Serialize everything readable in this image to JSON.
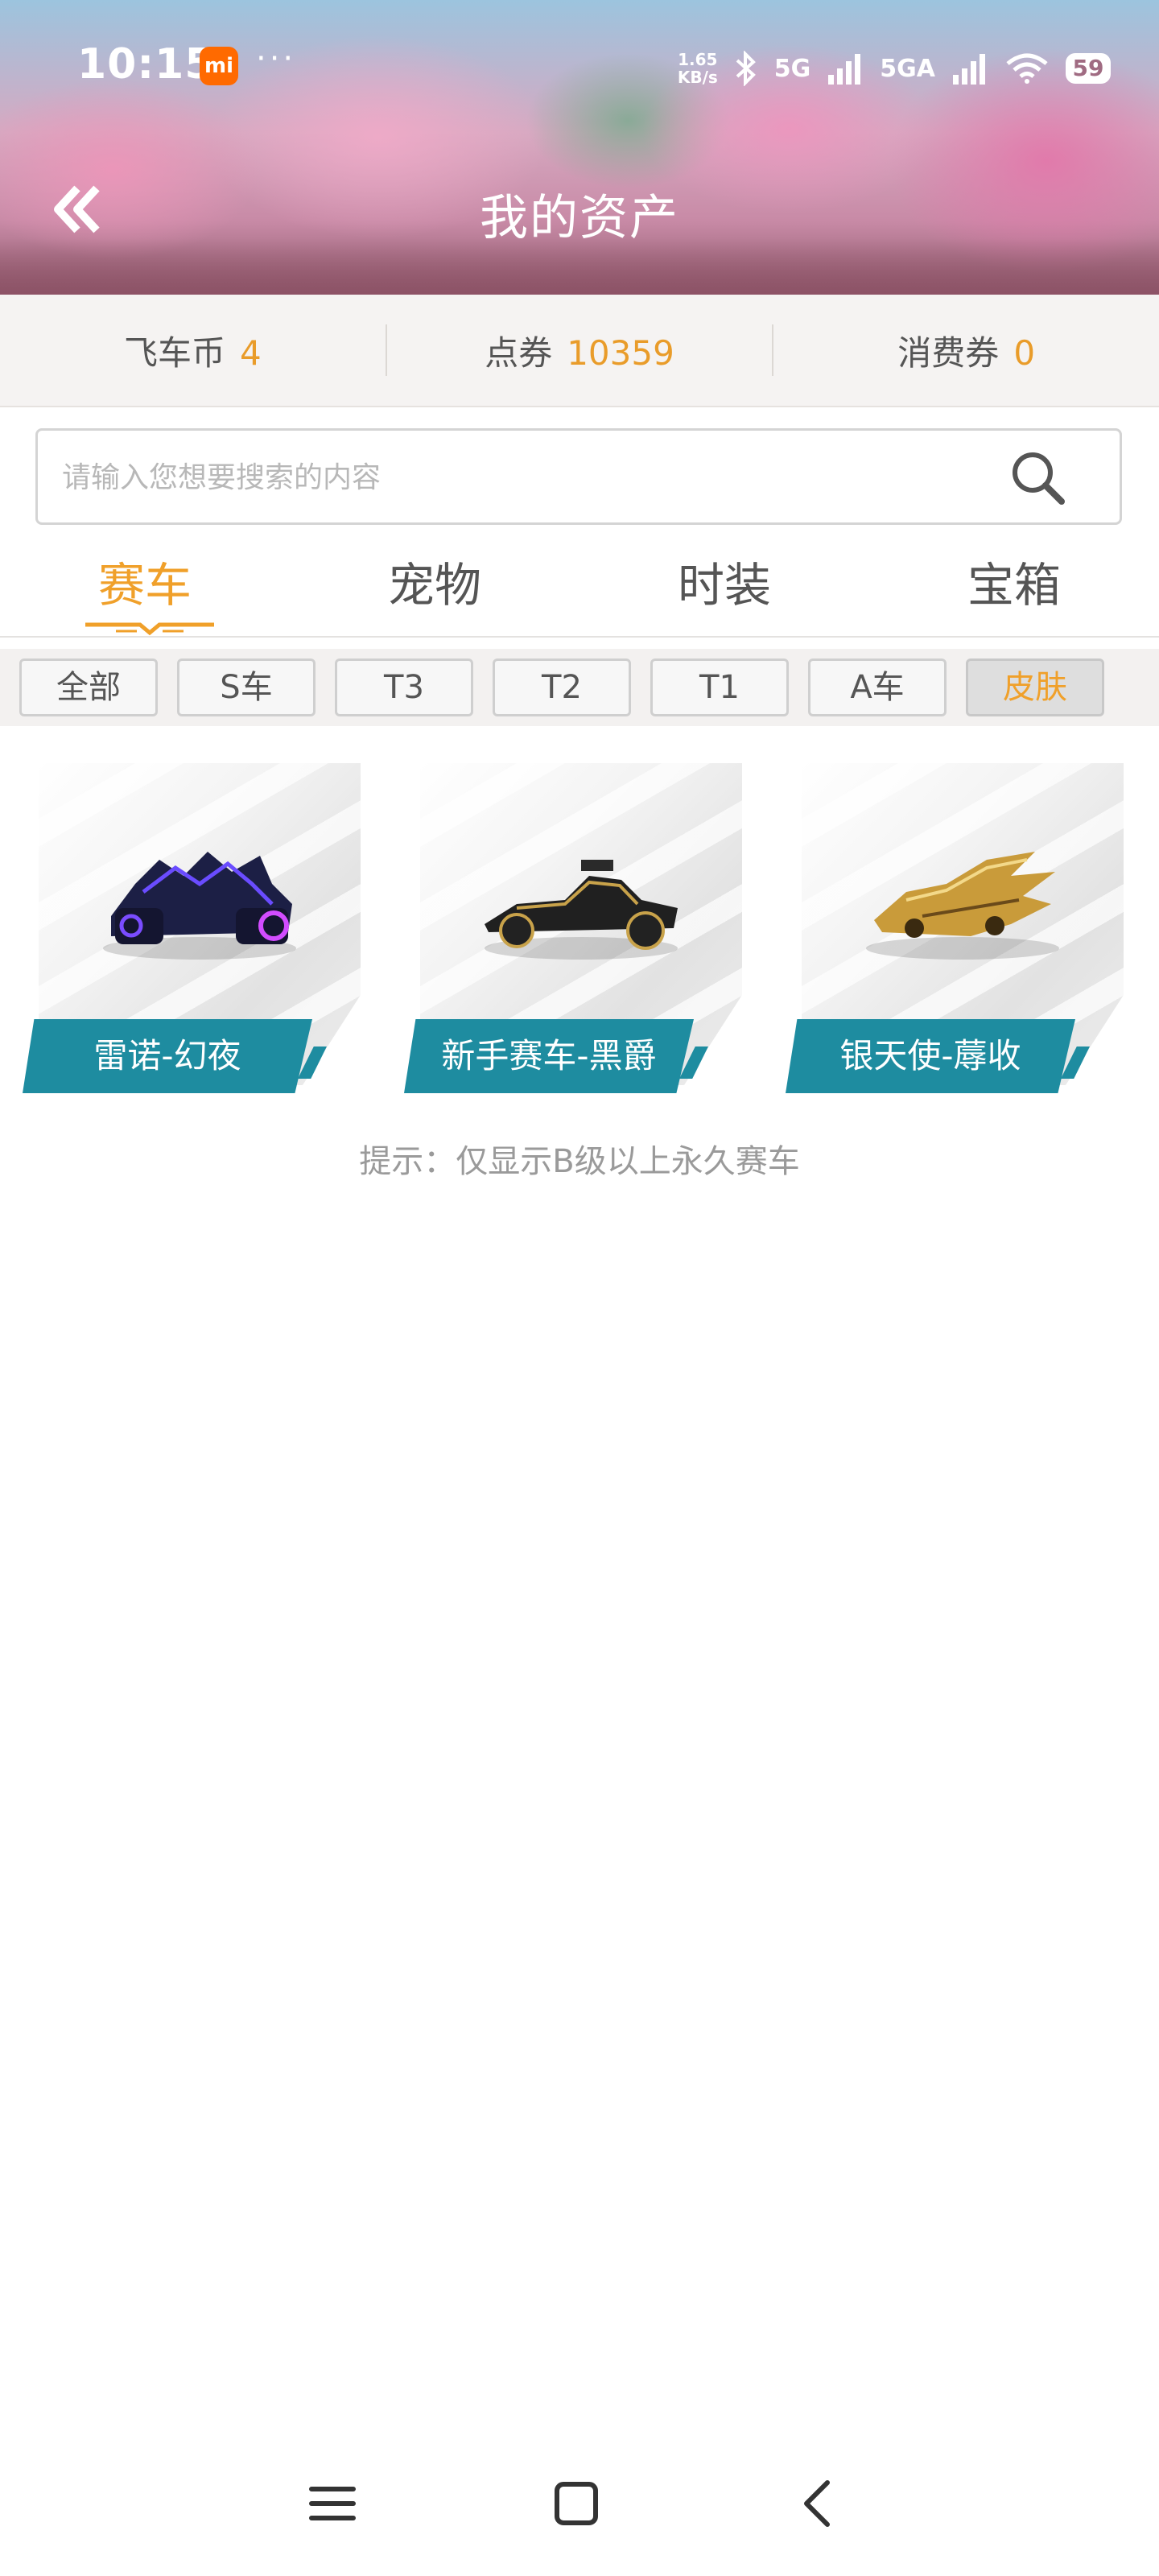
{
  "status_bar": {
    "time": "10:15",
    "app_badge": "mi",
    "dots": "···",
    "net_speed_value": "1.65",
    "net_speed_unit": "KB/s",
    "signal1": "5G",
    "signal2": "5GA",
    "battery": "59"
  },
  "header": {
    "title": "我的资产",
    "back_icon": "double-chevron-left-icon"
  },
  "currencies": [
    {
      "label": "飞车币",
      "value": "4"
    },
    {
      "label": "点券",
      "value": "10359"
    },
    {
      "label": "消费券",
      "value": "0"
    }
  ],
  "search": {
    "placeholder": "请输入您想要搜索的内容",
    "value": "",
    "icon": "search-icon"
  },
  "tabs": [
    {
      "label": "赛车",
      "active": true
    },
    {
      "label": "宠物",
      "active": false
    },
    {
      "label": "时装",
      "active": false
    },
    {
      "label": "宝箱",
      "active": false
    }
  ],
  "filters": [
    {
      "label": "全部",
      "active": false
    },
    {
      "label": "S车",
      "active": false
    },
    {
      "label": "T3",
      "active": false
    },
    {
      "label": "T2",
      "active": false
    },
    {
      "label": "T1",
      "active": false
    },
    {
      "label": "A车",
      "active": false
    },
    {
      "label": "皮肤",
      "active": true
    }
  ],
  "cars": [
    {
      "name": "雷诺-幻夜"
    },
    {
      "name": "新手赛车-黑爵"
    },
    {
      "name": "银天使-蓐收"
    }
  ],
  "hint": "提示：仅显示B级以上永久赛车",
  "colors": {
    "accent": "#f0a02a",
    "value": "#e99c2a",
    "card_label": "#1e8ca0"
  },
  "nav": [
    "menu-icon",
    "home-square-icon",
    "back-chevron-icon"
  ]
}
